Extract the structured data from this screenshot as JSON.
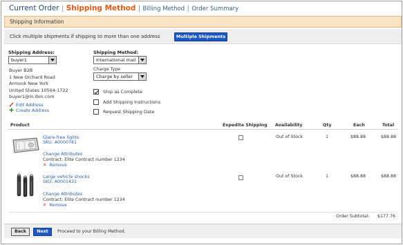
{
  "breadcrumb": {
    "current_order": "Current Order",
    "separator": "|",
    "shipping": "Shipping Method",
    "billing": "Billing Method",
    "summary": "Order Summary"
  },
  "section_title": "Shipping Information",
  "multiple_shipments": {
    "text": "Click multiple shipments if shipping to more than one address",
    "button": "Multiple Shipments"
  },
  "shipping_address": {
    "label": "Shipping Address:",
    "selected": "buyer1",
    "lines": [
      "Buyer B2B",
      "1 New Orchard Road",
      "Armonk New York",
      "United States 10504-1722",
      "buyer1@in.ibm.com"
    ],
    "edit": "Edit Address",
    "create": "Create Address"
  },
  "shipping_method": {
    "label": "Shipping Method:",
    "selected": "International mail",
    "charge_label": "Charge Type",
    "charge_selected": "Charge by seller"
  },
  "options": [
    {
      "label": "Ship as Complete",
      "checked": true
    },
    {
      "label": "Add Shipping Instructions",
      "checked": false
    },
    {
      "label": "Request Shipping Date",
      "checked": false
    }
  ],
  "table": {
    "headers": {
      "product": "Product",
      "expedite": "Expedite Shipping",
      "availability": "Availability",
      "qty": "Qty",
      "each": "Each",
      "total": "Total"
    },
    "rows": [
      {
        "name": "Glare-free lights",
        "sku": "SKU: A0000781",
        "change": "Change Attributes",
        "contract": "Contract: Elite Contract number 1234",
        "remove": "Remove",
        "availability": "Out of Stock",
        "qty": "1",
        "each": "$88.88",
        "total": "$88.88"
      },
      {
        "name": "Large vehicle shocks",
        "sku": "SKU: A0001431",
        "change": "Change Attributes",
        "contract": "Contract: Elite Contract number 1234",
        "remove": "Remove",
        "availability": "Out of Stock",
        "qty": "1",
        "each": "$88.88",
        "total": "$88.88"
      }
    ],
    "subtotal_label": "Order Subtotal:",
    "subtotal_value": "$177.76"
  },
  "footer": {
    "back": "Back",
    "next": "Next",
    "text": "Proceed to your Billing Method."
  }
}
